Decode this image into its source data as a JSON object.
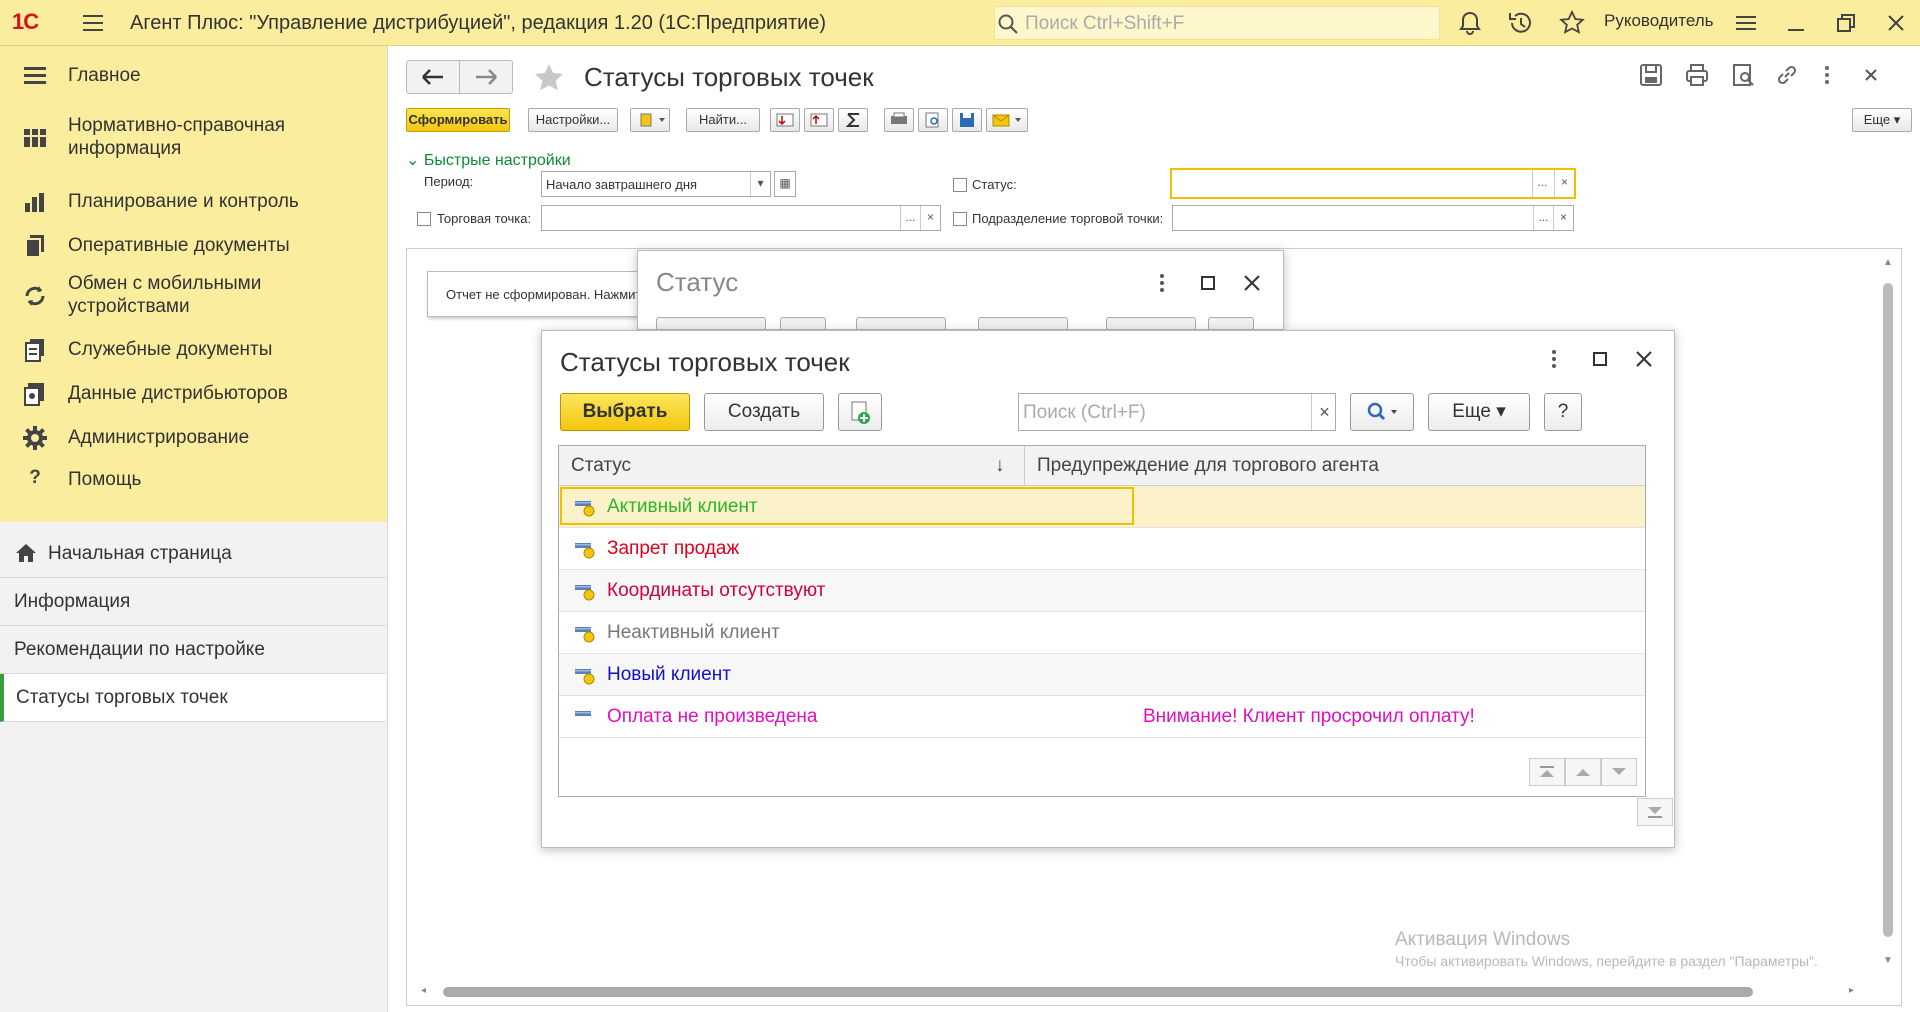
{
  "topbar": {
    "logo": "1С",
    "title": "Агент Плюс: \"Управление дистрибуцией\", редакция 1.20  (1С:Предприятие)",
    "search_placeholder": "Поиск Ctrl+Shift+F",
    "user": "Руководитель",
    "accent": "#fbed9e"
  },
  "sidebar": {
    "sections": [
      {
        "label": "Главное",
        "icon": "hamburger-icon"
      },
      {
        "label": "Нормативно-справочная информация",
        "icon": "catalog-icon"
      },
      {
        "label": "Планирование и контроль",
        "icon": "bar-chart-icon"
      },
      {
        "label": "Оперативные документы",
        "icon": "documents-icon"
      },
      {
        "label": "Обмен с мобильными устройствами",
        "icon": "sync-icon"
      },
      {
        "label": "Служебные документы",
        "icon": "service-docs-icon"
      },
      {
        "label": "Данные дистрибьюторов",
        "icon": "distributor-data-icon"
      },
      {
        "label": "Администрирование",
        "icon": "gear-icon"
      },
      {
        "label": "Помощь",
        "icon": "question-icon"
      }
    ],
    "links": [
      {
        "label": "Начальная страница"
      },
      {
        "label": "Информация"
      },
      {
        "label": "Рекомендации по настройке"
      },
      {
        "label": "Статусы торговых точек"
      }
    ]
  },
  "page": {
    "title": "Статусы торговых точек",
    "toolbar": {
      "generate": "Сформировать",
      "settings": "Настройки...",
      "find": "Найти...",
      "more": "Еще",
      "help": "?"
    },
    "quick_settings": "Быстрые настройки",
    "filters": {
      "period_label": "Период:",
      "period_value": "Начало завтрашнего дня",
      "status_label": "Статус:",
      "outlet_label": "Торговая точка:",
      "subdivision_label": "Подразделение торговой точки:"
    },
    "report_message": "Отчет не сформирован. Нажмит"
  },
  "dialog_status": {
    "title": "Статус"
  },
  "dialog_list": {
    "title": "Статусы торговых точек",
    "select": "Выбрать",
    "create": "Создать",
    "search_placeholder": "Поиск (Ctrl+F)",
    "more": "Еще",
    "help": "?",
    "columns": {
      "status": "Статус",
      "sort_arrow": "↓",
      "warning": "Предупреждение для торгового агента"
    },
    "rows": [
      {
        "status": "Активный клиент",
        "warning": "",
        "color": "#2db52d",
        "marker": true
      },
      {
        "status": "Запрет продаж",
        "warning": "",
        "color": "#e0001b",
        "marker": true
      },
      {
        "status": "Координаты отсутствуют",
        "warning": "",
        "color": "#d0003a",
        "marker": true
      },
      {
        "status": "Неактивный клиент",
        "warning": "",
        "color": "#777777",
        "marker": true
      },
      {
        "status": "Новый клиент",
        "warning": "",
        "color": "#1010c8",
        "marker": true
      },
      {
        "status": "Оплата не произведена",
        "warning": "Внимание! Клиент просрочил оплату!",
        "color": "#e010c0",
        "marker": false
      }
    ]
  },
  "watermark": {
    "line1": "Активация Windows",
    "line2": "Чтобы активировать Windows, перейдите в раздел \"Параметры\"."
  }
}
